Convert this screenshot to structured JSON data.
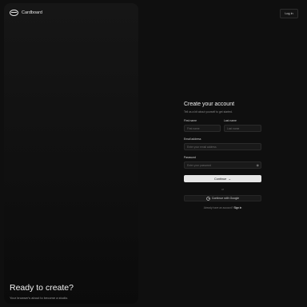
{
  "brand": {
    "name": "Cardboard"
  },
  "header": {
    "login_label": "Log in"
  },
  "hero": {
    "title": "Ready to create?",
    "subtitle": "Your browser's about to become a studio."
  },
  "form": {
    "title": "Create your account",
    "subtitle": "Tell us a bit about yourself to get started.",
    "first_name": {
      "label": "First name",
      "placeholder": "First name"
    },
    "last_name": {
      "label": "Last name",
      "placeholder": "Last name"
    },
    "email": {
      "label": "Email address",
      "placeholder": "Enter your email address"
    },
    "password": {
      "label": "Password",
      "placeholder": "Enter your password"
    },
    "continue_label": "Continue",
    "continue_arrow": "→",
    "divider_text": "or",
    "google_label": "Continue with Google",
    "signin_prompt": "Already have an account?",
    "signin_link": "Sign in"
  },
  "icons": {
    "password_toggle": "eye-icon",
    "google": "google-icon",
    "logo": "cardboard-logo"
  },
  "colors": {
    "background": "#0f0f0f",
    "primary_button": "#e6e6e6",
    "input_bg": "#191919"
  }
}
